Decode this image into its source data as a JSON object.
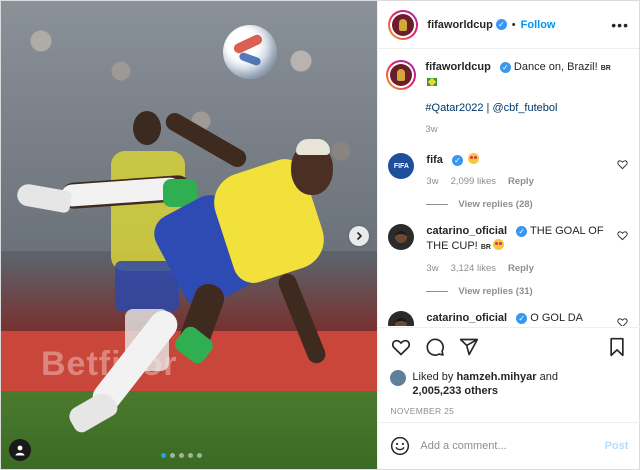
{
  "post": {
    "header": {
      "username": "fifaworldcup",
      "separator": "•",
      "follow_label": "Follow",
      "more_icon": "more-horizontal-icon"
    },
    "caption": {
      "username": "fifaworldcup",
      "text": "Dance on, Brazil!",
      "flag_text": "BR",
      "hashtags": "#Qatar2022 | @cbf_futebol",
      "age": "3w"
    },
    "comments": [
      {
        "username": "fifa",
        "avatar_text": "FIFA",
        "text": "",
        "emoji": "star-struck-emoji",
        "age": "3w",
        "likes": "2,099 likes",
        "reply_label": "Reply",
        "view_replies": "View replies (28)"
      },
      {
        "username": "catarino_oficial",
        "text": "THE GOAL OF THE CUP!",
        "flag_text": "BR",
        "emoji": "star-struck-emoji",
        "age": "3w",
        "likes": "3,124 likes",
        "reply_label": "Reply",
        "view_replies": "View replies (31)"
      },
      {
        "username": "catarino_oficial",
        "text": "O GOL DA COPA!"
      }
    ],
    "actions": {
      "like_icon": "heart-icon",
      "comment_icon": "comment-icon",
      "share_icon": "share-icon",
      "save_icon": "bookmark-icon"
    },
    "likes": {
      "prefix": "Liked by",
      "user": "hamzeh.mihyar",
      "and": "and",
      "count": "2,005,233 others"
    },
    "date": "NOVEMBER 25",
    "add_comment": {
      "placeholder": "Add a comment...",
      "post_label": "Post",
      "emoji_icon": "smile-icon"
    },
    "media": {
      "banner_text": "Betfivor",
      "carousel_dots": 5,
      "active_dot": 1
    },
    "colors": {
      "accent": "#0095f6",
      "verified": "#3897f0",
      "muted": "#8e8e8e",
      "link": "#00376b"
    }
  }
}
